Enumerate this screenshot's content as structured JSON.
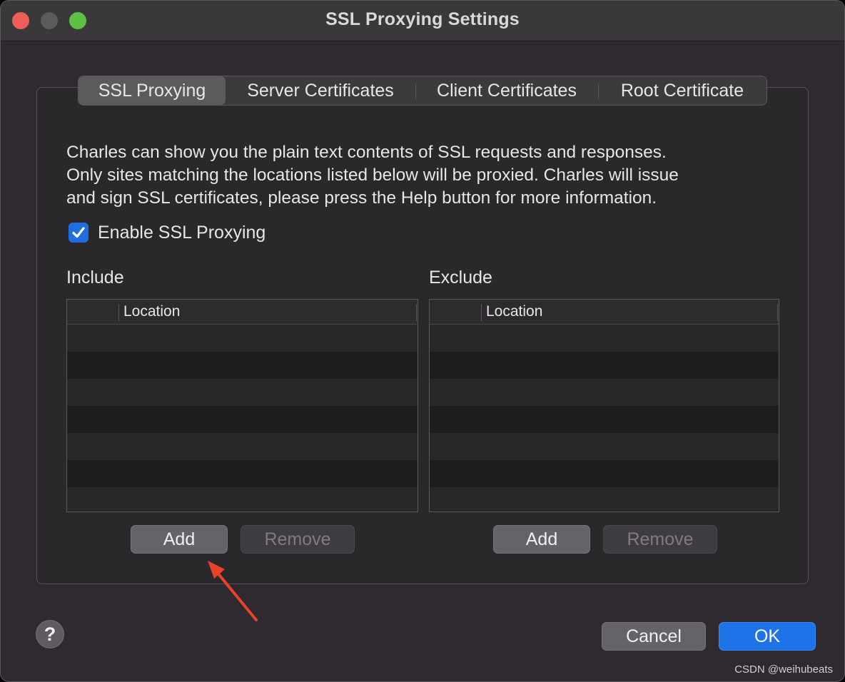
{
  "window": {
    "title": "SSL Proxying Settings"
  },
  "tabs": [
    {
      "label": "SSL Proxying",
      "active": true
    },
    {
      "label": "Server Certificates",
      "active": false
    },
    {
      "label": "Client Certificates",
      "active": false
    },
    {
      "label": "Root Certificate",
      "active": false
    }
  ],
  "description": [
    "Charles can show you the plain text contents of SSL requests and responses.",
    "Only sites matching the locations listed below will be proxied. Charles will issue",
    "and sign SSL certificates, please press the Help button for more information."
  ],
  "enable_ssl": {
    "label": "Enable SSL Proxying",
    "checked": true
  },
  "include": {
    "label": "Include",
    "columns": [
      "",
      "Location"
    ],
    "rows": [],
    "add_label": "Add",
    "remove_label": "Remove"
  },
  "exclude": {
    "label": "Exclude",
    "columns": [
      "",
      "Location"
    ],
    "rows": [],
    "add_label": "Add",
    "remove_label": "Remove"
  },
  "footer": {
    "help_label": "?",
    "cancel_label": "Cancel",
    "ok_label": "OK"
  },
  "watermark": "CSDN @weihubeats",
  "colors": {
    "accent": "#1f73e8",
    "annotation_arrow": "#e8412c",
    "close": "#ec5f56",
    "maximize": "#5ec146"
  }
}
